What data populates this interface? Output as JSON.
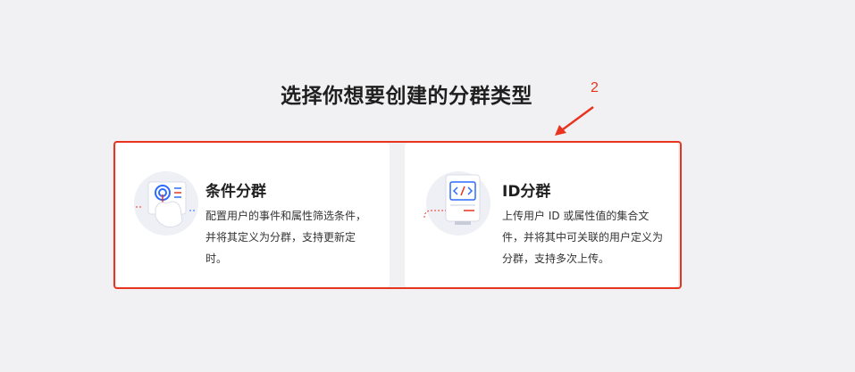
{
  "page": {
    "title": "选择你想要创建的分群类型"
  },
  "annotation": {
    "number": "2",
    "color": "#e8331f"
  },
  "cards": [
    {
      "title": "条件分群",
      "description": "配置用户的事件和属性筛选条件，并将其定义为分群，支持更新定时。",
      "icon": "condition-segment-illustration-icon"
    },
    {
      "title": "ID分群",
      "description": "上传用户 ID 或属性值的集合文件，并将其中可关联的用户定义为分群，支持多次上传。",
      "icon": "id-segment-illustration-icon"
    }
  ]
}
